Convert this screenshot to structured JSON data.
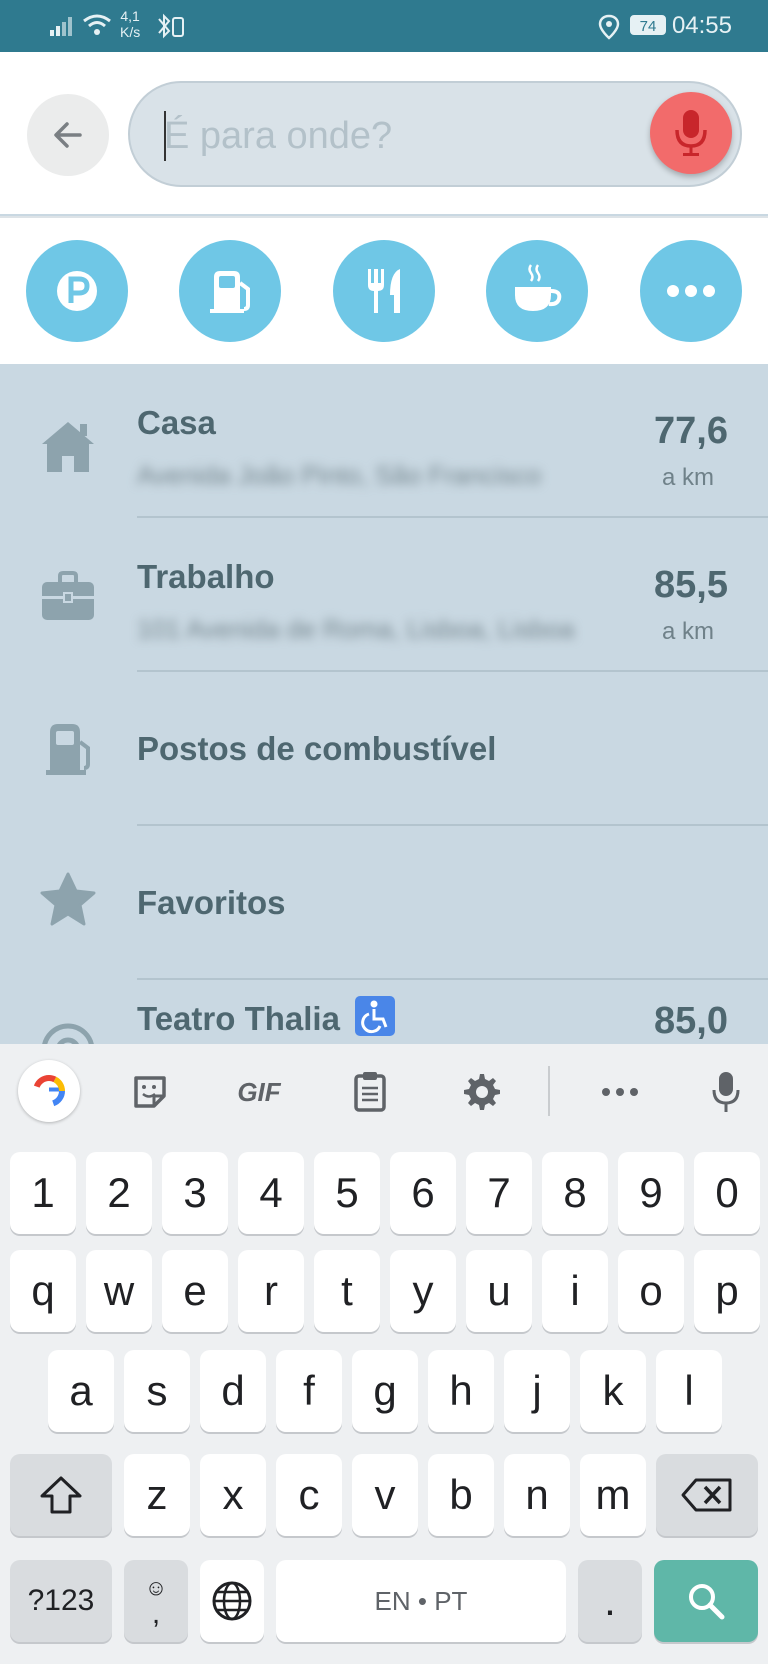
{
  "status_bar": {
    "net_speed_value": "4,1",
    "net_speed_unit": "K/s",
    "battery": "74",
    "time": "04:55"
  },
  "search": {
    "placeholder": "É para onde?"
  },
  "categories": [
    {
      "name": "parking",
      "icon": "parking-icon"
    },
    {
      "name": "fuel",
      "icon": "fuel-pump-icon"
    },
    {
      "name": "food",
      "icon": "fork-knife-icon"
    },
    {
      "name": "coffee",
      "icon": "coffee-cup-icon"
    },
    {
      "name": "more",
      "icon": "more-dots-icon"
    }
  ],
  "list": {
    "items": [
      {
        "title": "Casa",
        "subtitle": "Avenida João Pinto, São Francisco",
        "distance": "77,6",
        "unit": "a km",
        "icon": "home-icon"
      },
      {
        "title": "Trabalho",
        "subtitle": "101 Avenida de Roma, Lisboa, Lisboa",
        "distance": "85,5",
        "unit": "a km",
        "icon": "briefcase-icon"
      },
      {
        "title": "Postos de combustível",
        "icon": "fuel-pump-icon"
      },
      {
        "title": "Favoritos",
        "icon": "star-icon"
      },
      {
        "title": "Teatro Thalia",
        "distance": "85,0",
        "icon": "place-icon"
      }
    ]
  },
  "keyboard": {
    "toolbar": {
      "gif": "GIF"
    },
    "rows": [
      [
        "1",
        "2",
        "3",
        "4",
        "5",
        "6",
        "7",
        "8",
        "9",
        "0"
      ],
      [
        "q",
        "w",
        "e",
        "r",
        "t",
        "y",
        "u",
        "i",
        "o",
        "p"
      ],
      [
        "a",
        "s",
        "d",
        "f",
        "g",
        "h",
        "j",
        "k",
        "l"
      ],
      [
        "z",
        "x",
        "c",
        "v",
        "b",
        "n",
        "m"
      ]
    ],
    "symbols_label": "?123",
    "comma_label": ",",
    "space_label": "EN • PT",
    "period_label": "."
  },
  "colors": {
    "status_bar": "#2f7a8f",
    "category_button": "#6fc7e6",
    "mic_button": "#f26b6b",
    "search_key": "#5fb7a8"
  }
}
